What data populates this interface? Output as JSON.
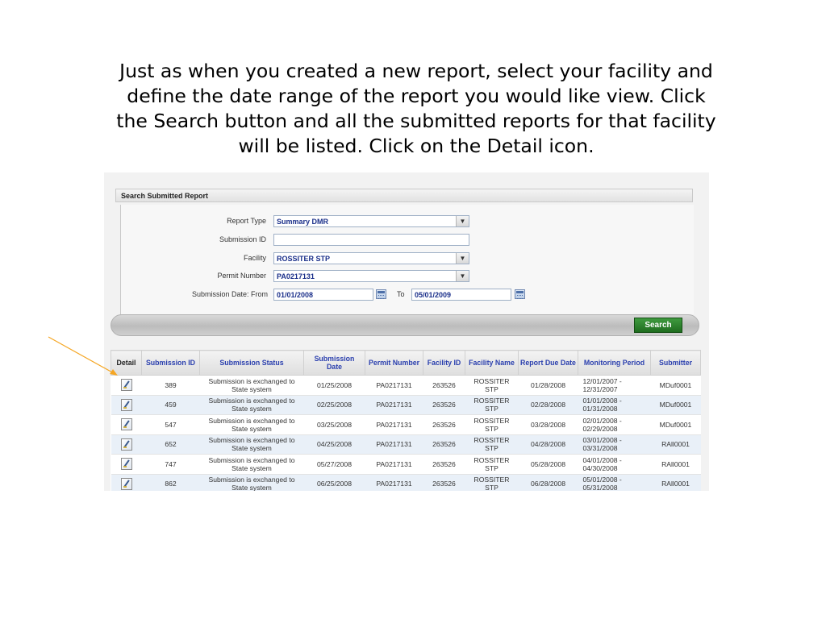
{
  "instructions": [
    "Just as when you created a new report, select your facility and",
    "define the date range of the report you would like view.  Click",
    "the Search button and all the submitted reports for that facility",
    "will be listed.  Click on the Detail icon."
  ],
  "colors": {
    "arrow": "#f5a623",
    "header_text": "#2a3fae",
    "search_button": "#2e842e",
    "row_alt": "#e9f0f8"
  },
  "panel": {
    "title": "Search Submitted Report",
    "fields": {
      "report_type": {
        "label": "Report Type",
        "value": "Summary DMR"
      },
      "submission_id": {
        "label": "Submission ID",
        "value": ""
      },
      "facility": {
        "label": "Facility",
        "value": "ROSSITER STP"
      },
      "permit_number": {
        "label": "Permit Number",
        "value": "PA0217131"
      },
      "submission_date": {
        "label": "Submission Date: From",
        "from": "01/01/2008",
        "to_label": "To",
        "to": "05/01/2009"
      }
    },
    "search_label": "Search"
  },
  "icons": {
    "select_arrow": "chevron-down-icon",
    "calendar": "calendar-icon",
    "detail": "edit-document-icon",
    "pointer": "arrow-annotation"
  },
  "table": {
    "headers": [
      "Detail",
      "Submission ID",
      "Submission Status",
      "Submission Date",
      "Permit Number",
      "Facility ID",
      "Facility Name",
      "Report Due Date",
      "Monitoring Period",
      "Submitter"
    ],
    "rows": [
      {
        "id": "389",
        "status": "Submission is exchanged to State system",
        "sub_date": "01/25/2008",
        "permit": "PA0217131",
        "facility_id": "263526",
        "facility_name": "ROSSITER STP",
        "due": "01/28/2008",
        "period": "12/01/2007 - 12/31/2007",
        "submitter": "MDuf0001"
      },
      {
        "id": "459",
        "status": "Submission is exchanged to State system",
        "sub_date": "02/25/2008",
        "permit": "PA0217131",
        "facility_id": "263526",
        "facility_name": "ROSSITER STP",
        "due": "02/28/2008",
        "period": "01/01/2008 - 01/31/2008",
        "submitter": "MDuf0001"
      },
      {
        "id": "547",
        "status": "Submission is exchanged to State system",
        "sub_date": "03/25/2008",
        "permit": "PA0217131",
        "facility_id": "263526",
        "facility_name": "ROSSITER STP",
        "due": "03/28/2008",
        "period": "02/01/2008 - 02/29/2008",
        "submitter": "MDuf0001"
      },
      {
        "id": "652",
        "status": "Submission is exchanged to State system",
        "sub_date": "04/25/2008",
        "permit": "PA0217131",
        "facility_id": "263526",
        "facility_name": "ROSSITER STP",
        "due": "04/28/2008",
        "period": "03/01/2008 - 03/31/2008",
        "submitter": "RAll0001"
      },
      {
        "id": "747",
        "status": "Submission is exchanged to State system",
        "sub_date": "05/27/2008",
        "permit": "PA0217131",
        "facility_id": "263526",
        "facility_name": "ROSSITER STP",
        "due": "05/28/2008",
        "period": "04/01/2008 - 04/30/2008",
        "submitter": "RAll0001"
      },
      {
        "id": "862",
        "status": "Submission is exchanged to State system",
        "sub_date": "06/25/2008",
        "permit": "PA0217131",
        "facility_id": "263526",
        "facility_name": "ROSSITER STP",
        "due": "06/28/2008",
        "period": "05/01/2008 - 05/31/2008",
        "submitter": "RAll0001"
      }
    ]
  }
}
